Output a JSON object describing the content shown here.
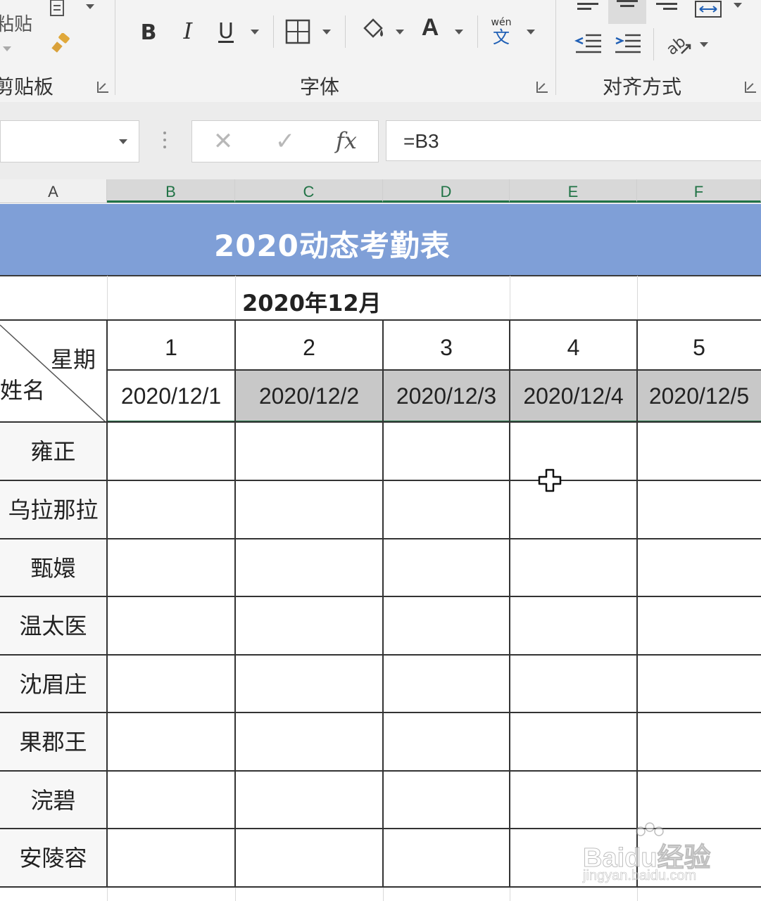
{
  "ribbon": {
    "clipboard_group": {
      "label": "剪贴板",
      "paste_label": "粘贴"
    },
    "font_group": {
      "label": "字体",
      "bold": "B",
      "italic": "I",
      "underline": "U",
      "font_color_glyph": "A",
      "phonetic_top": "wén",
      "phonetic_bottom": "文"
    },
    "align_group": {
      "label": "对齐方式"
    }
  },
  "formula_bar": {
    "name_box": "",
    "cancel_glyph": "✕",
    "enter_glyph": "✓",
    "fx_glyph": "fx",
    "formula": "=B3"
  },
  "columns": [
    "A",
    "B",
    "C",
    "D",
    "E",
    "F"
  ],
  "selected_columns": [
    "B",
    "C",
    "D",
    "E",
    "F"
  ],
  "sheet": {
    "title": "2020动态考勤表",
    "month": "2020年12月",
    "corner_top": "星期",
    "corner_bottom": "姓名",
    "day_numbers": [
      "1",
      "2",
      "3",
      "4",
      "5"
    ],
    "dates": [
      "2020/12/1",
      "2020/12/2",
      "2020/12/3",
      "2020/12/4",
      "2020/12/5"
    ],
    "names": [
      "雍正",
      "乌拉那拉",
      "甄嬛",
      "温太医",
      "沈眉庄",
      "果郡王",
      "浣碧",
      "安陵容"
    ]
  },
  "watermark": {
    "main": "Baidu经验",
    "sub": "jingyan.baidu.com"
  },
  "colors": {
    "title_band": "#7f9fd7",
    "selection": "#217346",
    "shaded_date": "#c8c8c8"
  }
}
